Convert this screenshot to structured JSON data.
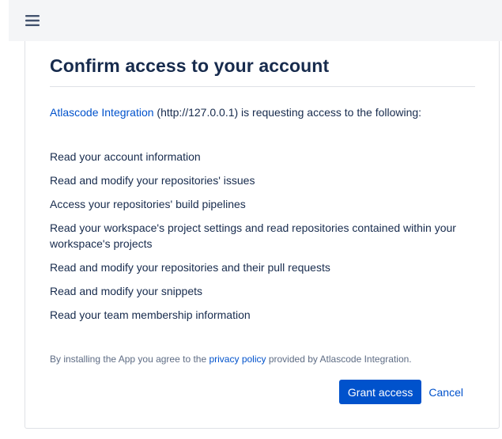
{
  "header": {
    "menu_icon": "hamburger-menu-icon"
  },
  "page": {
    "title": "Confirm access to your account",
    "intro": {
      "app_link": "Atlascode Integration",
      "rest": " (http://127.0.0.1) is requesting access to the following:"
    },
    "permissions": [
      "Read your account information",
      "Read and modify your repositories' issues",
      "Access your repositories' build pipelines",
      "Read your workspace's project settings and read repositories contained within your workspace's projects",
      "Read and modify your repositories and their pull requests",
      "Read and modify your snippets",
      "Read your team membership information"
    ],
    "legal": {
      "prefix": "By installing the App you agree to the ",
      "link": "privacy policy",
      "suffix": " provided by Atlascode Integration."
    },
    "actions": {
      "grant_label": "Grant access",
      "cancel_label": "Cancel"
    }
  },
  "colors": {
    "accent": "#0052cc",
    "text": "#172b4d",
    "muted": "#5e6c84",
    "topbar": "#f4f5f7",
    "border": "#dfe1e6"
  }
}
